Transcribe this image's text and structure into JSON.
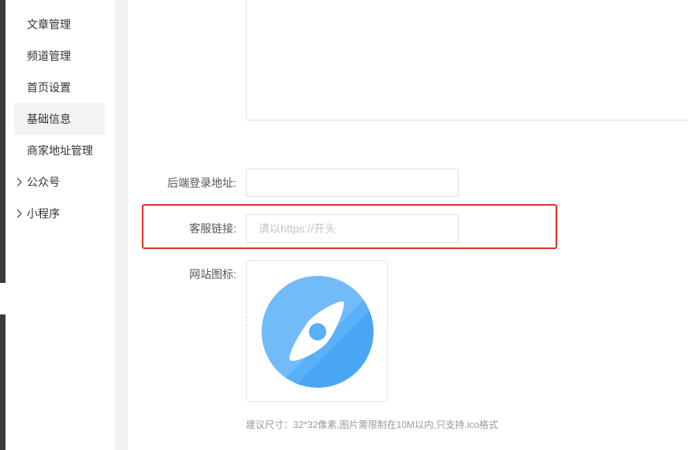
{
  "sidebar": {
    "items": [
      {
        "label": "文章管理"
      },
      {
        "label": "频道管理"
      },
      {
        "label": "首页设置"
      },
      {
        "label": "基础信息"
      },
      {
        "label": "商家地址管理"
      }
    ],
    "groups": [
      {
        "label": "公众号"
      },
      {
        "label": "小程序"
      }
    ]
  },
  "form": {
    "login_url": {
      "label": "后端登录地址:",
      "value": "",
      "placeholder": ""
    },
    "service_link": {
      "label": "客服链接:",
      "value": "",
      "placeholder": "请以https://开头"
    },
    "site_icon": {
      "label": "网站图标:",
      "icon": "compass-icon",
      "hint": "建议尺寸：32*32像素,图片需限制在10M以内,只支持.ico格式"
    }
  },
  "colors": {
    "highlight": "#e0312b",
    "icon_blue": "#5ab0f7",
    "active_bg": "#f2f3f5"
  }
}
